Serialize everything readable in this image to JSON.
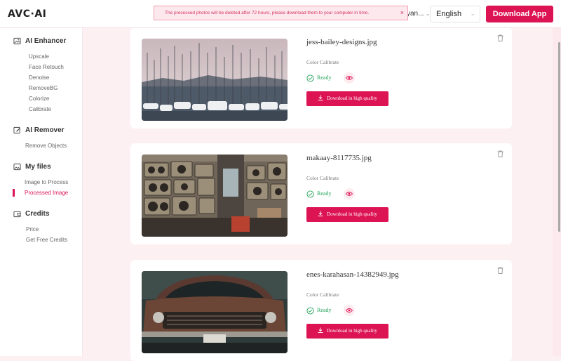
{
  "header": {
    "logo": "AVC·AI",
    "user_name": "yan...",
    "language": "English",
    "download_app_label": "Download App"
  },
  "toast": {
    "message": "The processed photos will be deleted after 72 hours, please download them to your computer in time.",
    "close_glyph": "×"
  },
  "sidebar": {
    "sections": [
      {
        "title": "AI Enhancer",
        "icon": "image-icon",
        "items": [
          "Upscale",
          "Face Retouch",
          "Denoise",
          "RemoveBG",
          "Colorize",
          "Calibrate"
        ]
      },
      {
        "title": "AI Remover",
        "icon": "pen-icon",
        "items": [
          "Remove Objects"
        ]
      },
      {
        "title": "My files",
        "icon": "photos-icon",
        "items": [
          "Image to Process",
          "Processed Image"
        ],
        "active": "Processed Image"
      },
      {
        "title": "Credits",
        "icon": "wallet-icon",
        "items": [
          "Price",
          "Get Free Credits"
        ]
      }
    ]
  },
  "cards": [
    {
      "filename": "jess-bailey-designs.jpg",
      "method": "Color Calibrate",
      "status": "Ready",
      "download_label": "Download in high quality"
    },
    {
      "filename": "makaay-8117735.jpg",
      "method": "Color Calibrate",
      "status": "Ready",
      "download_label": "Download in high quality"
    },
    {
      "filename": "enes-karahasan-14382949.jpg",
      "method": "Color Calibrate",
      "status": "Ready",
      "download_label": "Download in high quality"
    }
  ],
  "colors": {
    "accent": "#dc1454",
    "ready": "#22a35a",
    "background": "#fdf0f3"
  }
}
